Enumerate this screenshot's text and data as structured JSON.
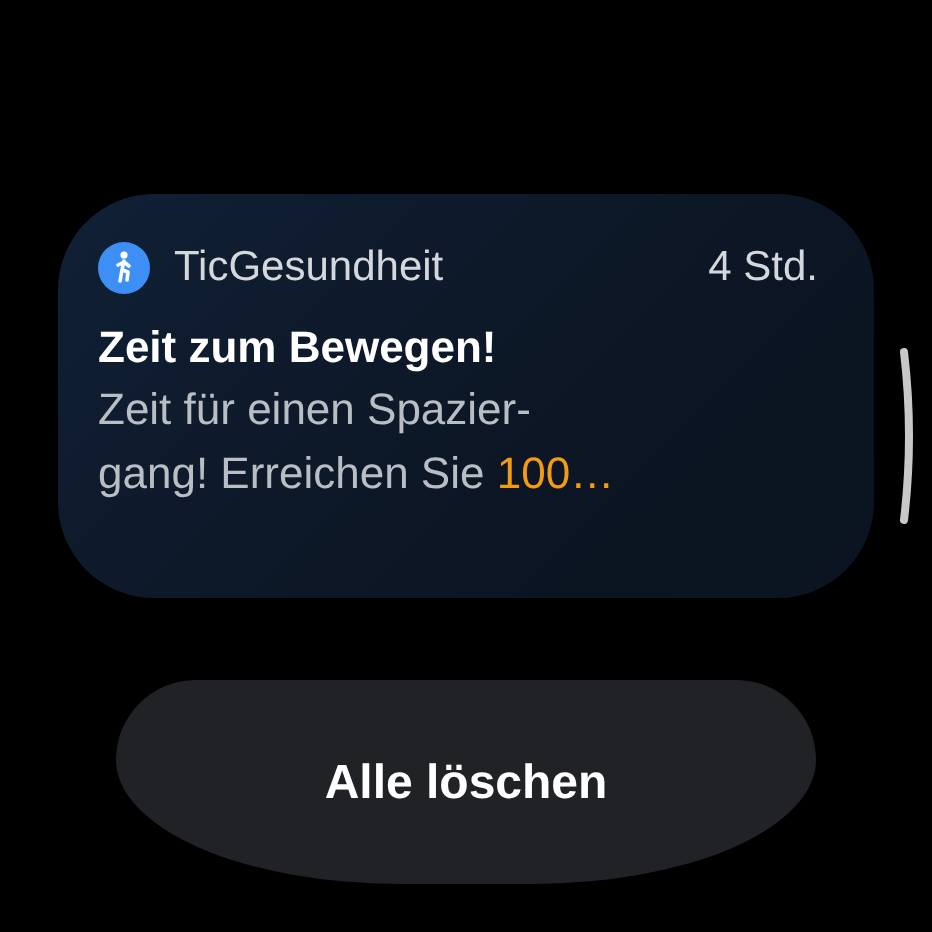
{
  "notification": {
    "app_name": "TicGesundheit",
    "time": "4 Std.",
    "title": "Zeit zum Bewegen!",
    "body_lines": [
      "Zeit für einen Spazier-",
      "gang! Erreichen Sie"
    ],
    "body_highlight": "100…"
  },
  "button": {
    "label": "Alle löschen"
  }
}
